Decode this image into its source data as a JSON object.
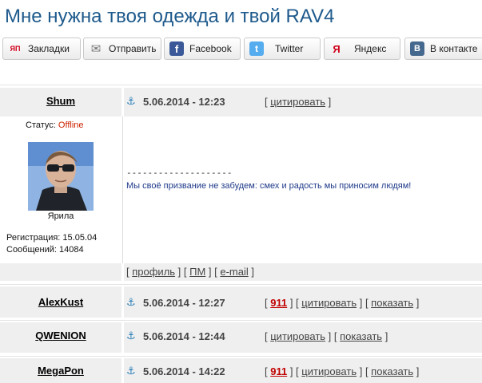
{
  "page": {
    "title": "Мне нужна твоя одежда и твой RAV4"
  },
  "share": [
    {
      "label": "Закладки",
      "icon": "yandex-bookmarks-icon",
      "glyph": "ЯП",
      "bg": "#ffffff",
      "fg": "#d0021b"
    },
    {
      "label": "Отправить",
      "icon": "envelope-icon",
      "glyph": "✉",
      "bg": "#ffffff",
      "fg": "#777777"
    },
    {
      "label": "Facebook",
      "icon": "facebook-icon",
      "glyph": "f",
      "bg": "#3b5998",
      "fg": "#ffffff"
    },
    {
      "label": "Twitter",
      "icon": "twitter-icon",
      "glyph": "t",
      "bg": "#55acee",
      "fg": "#ffffff"
    },
    {
      "label": "Яндекс",
      "icon": "yandex-icon",
      "glyph": "Я",
      "bg": "#ffffff",
      "fg": "#d0021b"
    },
    {
      "label": "В контакте",
      "icon": "vk-icon",
      "glyph": "B",
      "bg": "#45688e",
      "fg": "#ffffff"
    }
  ],
  "first_post": {
    "author": "Shum",
    "date": "5.06.2014 - 12:23",
    "cite_label": "цитировать",
    "status_label": "Статус:",
    "status_value": "Offline",
    "avatar_caption": "Ярила",
    "reg_label": "Регистрация:",
    "reg_value": "15.05.04",
    "posts_label": "Сообщений:",
    "posts_value": "14084",
    "separator": "--------------------",
    "signature": "Мы своё призвание не забудем: смех и радость мы приносим людям!",
    "profile_label": "профиль",
    "pm_label": "ПМ",
    "email_label": "e-mail"
  },
  "posts": [
    {
      "author": "AlexKust",
      "date": "5.06.2014 - 12:27",
      "badge": "911",
      "cite_label": "цитировать",
      "show_label": "показать"
    },
    {
      "author": "QWENION",
      "date": "5.06.2014 - 12:44",
      "cite_label": "цитировать",
      "show_label": "показать"
    },
    {
      "author": "MegaPon",
      "date": "5.06.2014 - 14:22",
      "badge": "911",
      "cite_label": "цитировать",
      "show_label": "показать"
    }
  ],
  "colors": {
    "title": "#1e5a8c",
    "anchor": "#2a7fb8",
    "badge": "#c00000",
    "offline": "#cc2200",
    "row_bg": "#efefef"
  }
}
